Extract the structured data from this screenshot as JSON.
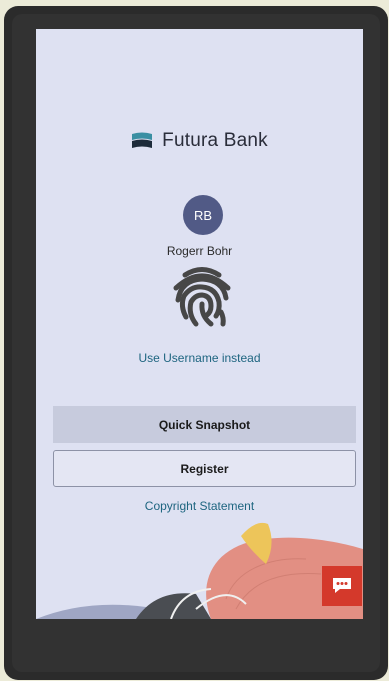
{
  "app": {
    "brand_name": "Futura Bank",
    "brand_icon": "futura-logo-icon",
    "brand_color": "#3a8fa3"
  },
  "user": {
    "initials": "RB",
    "name": "Rogerr Bohr",
    "avatar_color": "#515a86"
  },
  "login": {
    "biometric_icon": "fingerprint-icon",
    "alt_method_link": "Use Username instead"
  },
  "actions": {
    "quick_snapshot_label": "Quick Snapshot",
    "register_label": "Register"
  },
  "footer": {
    "copyright_link": "Copyright Statement"
  },
  "chat": {
    "icon": "chat-icon",
    "color": "#d4392b"
  },
  "tabbar": {
    "tabs": [
      {
        "icon": "check-circle-icon"
      },
      {
        "icon": "scan-icon"
      },
      {
        "icon": "settings-icon"
      },
      {
        "icon": "more-icon"
      }
    ],
    "background": "#4b5270"
  }
}
